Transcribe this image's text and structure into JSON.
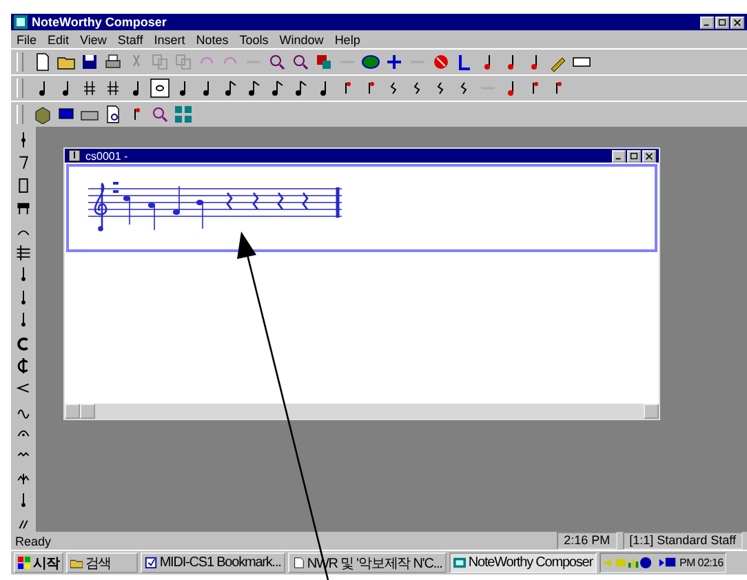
{
  "window": {
    "title": "NoteWorthy Composer"
  },
  "menu": [
    "File",
    "Edit",
    "View",
    "Staff",
    "Insert",
    "Notes",
    "Tools",
    "Window",
    "Help"
  ],
  "document": {
    "title": "cs0001 -"
  },
  "status_bar": {
    "message": "Ready",
    "time": "2:16 PM",
    "staff": "[1:1] Standard Staff"
  },
  "taskbar": {
    "start": "시작",
    "buttons": [
      {
        "label": "검색",
        "selected": false
      },
      {
        "label": "MIDI-CS1 Bookmark...",
        "selected": false
      },
      {
        "label": "NWR 및 '악보제작 N'C...",
        "selected": false
      },
      {
        "label": "NoteWorthy Composer",
        "selected": true
      }
    ],
    "clock": "PM 02:16"
  }
}
